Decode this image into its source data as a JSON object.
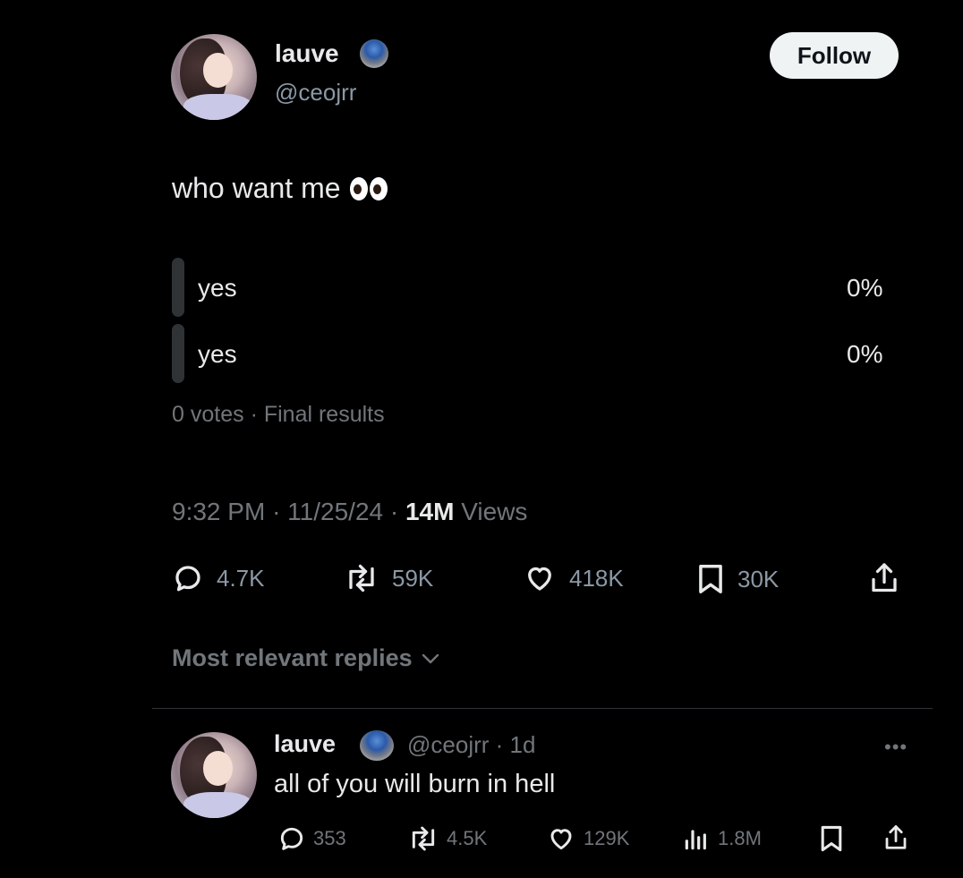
{
  "tweet": {
    "author": {
      "name": "lauve",
      "handle": "@ceojrr"
    },
    "follow_label": "Follow",
    "text": "who want me",
    "emoji": "eyes-emoji",
    "poll": {
      "options": [
        {
          "label": "yes",
          "percent": "0%"
        },
        {
          "label": "yes",
          "percent": "0%"
        }
      ],
      "votes": "0 votes",
      "status": "Final results"
    },
    "time": "9:32 PM",
    "date": "11/25/24",
    "views_count": "14M",
    "views_label": "Views",
    "stats": {
      "replies": "4.7K",
      "reposts": "59K",
      "likes": "418K",
      "bookmarks": "30K"
    }
  },
  "replies_sort_label": "Most relevant replies",
  "reply": {
    "name": "lauve",
    "handle": "@ceojrr",
    "age": "1d",
    "text": "all of you will burn in hell",
    "stats": {
      "replies": "353",
      "reposts": "4.5K",
      "likes": "129K",
      "views": "1.8M"
    },
    "more_label": "•••"
  },
  "colors": {
    "background": "#000000",
    "text": "#e7e9ea",
    "secondary": "#71767b",
    "follow_bg": "#eff3f4"
  },
  "icons": [
    "verified-badge-icon",
    "reply-icon",
    "repost-icon",
    "like-icon",
    "bookmark-icon",
    "share-icon",
    "views-icon",
    "chevron-down-icon",
    "more-icon"
  ]
}
